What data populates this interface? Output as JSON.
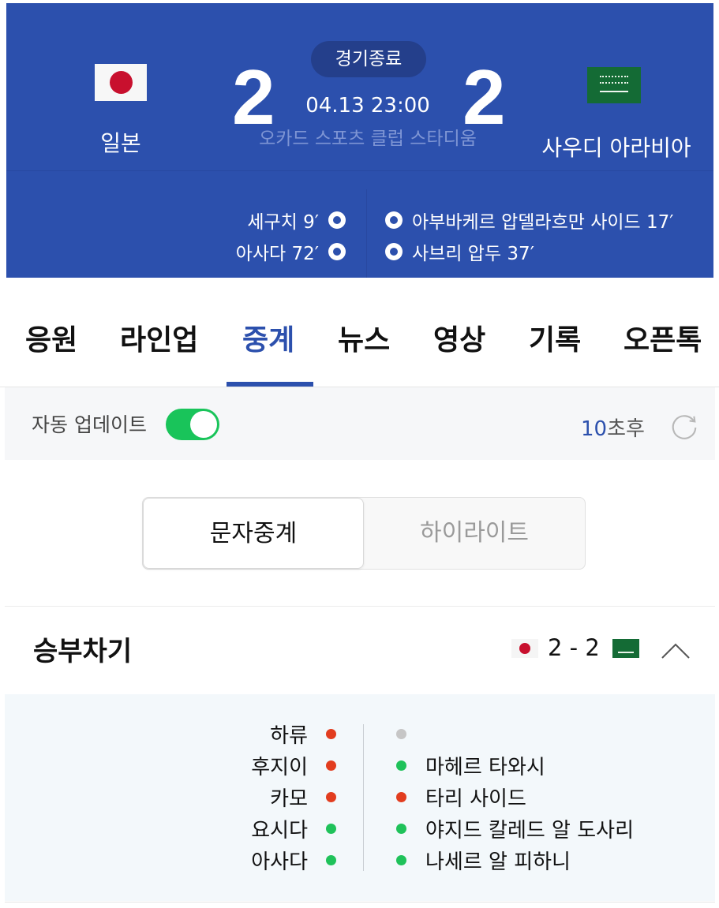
{
  "match": {
    "status": "경기종료",
    "datetime": "04.13 23:00",
    "stadium": "오카드 스포츠 클럽 스타디움",
    "home": {
      "name": "일본",
      "score": "2",
      "flag_icon": "japan-flag-icon"
    },
    "away": {
      "name": "사우디 아라비아",
      "score": "2",
      "flag_icon": "saudi-arabia-flag-icon"
    },
    "home_goals": [
      "세구치 9′",
      "아사다 72′"
    ],
    "away_goals": [
      "아부바케르 압델라흐만 사이드 17′",
      "사브리 압두 37′"
    ]
  },
  "tabs": [
    "응원",
    "라인업",
    "중계",
    "뉴스",
    "영상",
    "기록",
    "오픈톡"
  ],
  "active_tab": "중계",
  "auto_update": {
    "label": "자동 업데이트",
    "enabled": true,
    "countdown_value": "10",
    "countdown_unit": "초후"
  },
  "segment": {
    "options": [
      "문자중계",
      "하이라이트"
    ],
    "selected": "문자중계"
  },
  "shootout": {
    "title": "승부차기",
    "summary_score": "2 - 2",
    "home": [
      {
        "player": "하류",
        "result": "miss"
      },
      {
        "player": "후지이",
        "result": "miss"
      },
      {
        "player": "카모",
        "result": "miss"
      },
      {
        "player": "요시다",
        "result": "goal"
      },
      {
        "player": "아사다",
        "result": "goal"
      }
    ],
    "away": [
      {
        "player": "",
        "result": "none"
      },
      {
        "player": "마헤르 타와시",
        "result": "goal"
      },
      {
        "player": "타리 사이드",
        "result": "miss"
      },
      {
        "player": "야지드 칼레드 알 도사리",
        "result": "goal"
      },
      {
        "player": "나세르 알 피하니",
        "result": "goal"
      }
    ]
  },
  "colors": {
    "brand_blue": "#2c50ad",
    "goal": "#1fc25a",
    "miss": "#e23d1f",
    "none": "#c6c6c6",
    "toggle_on": "#19c45a"
  }
}
